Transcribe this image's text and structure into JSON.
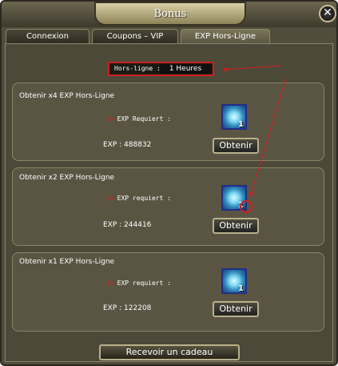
{
  "window": {
    "title": "Bonus"
  },
  "tabs": [
    {
      "label": "Connexion"
    },
    {
      "label": "Coupons – VIP"
    },
    {
      "label": "EXP Hors-Ligne"
    }
  ],
  "hours": {
    "label": "Hors-ligne :",
    "value": "1 Heures"
  },
  "panels": [
    {
      "title": "Obtenir x4 EXP Hors-Ligne",
      "req_num": "1x",
      "req_text": "EXP Requiert :",
      "exp_text": "EXP : 488832",
      "badge": "1",
      "button": "Obtenir"
    },
    {
      "title": "Obtenir x2 EXP Hors-Ligne",
      "req_num": "2x",
      "req_text": "EXP requiert :",
      "exp_text": "EXP : 244416",
      "badge": "1",
      "button": "Obtenir"
    },
    {
      "title": "Obtenir x1 EXP Hors-Ligne",
      "req_num": "1x",
      "req_text": "EXP requiert :",
      "exp_text": "EXP : 122208",
      "badge": "1",
      "button": "Obtenir"
    }
  ],
  "footer": {
    "button": "Recevoir un cadeau"
  },
  "colors": {
    "highlight": "#d01f1f",
    "panel": "#5a5543",
    "accent_text": "#d21d1d"
  },
  "icons": {
    "close": "close-icon",
    "item": "blue-orb-icon"
  }
}
